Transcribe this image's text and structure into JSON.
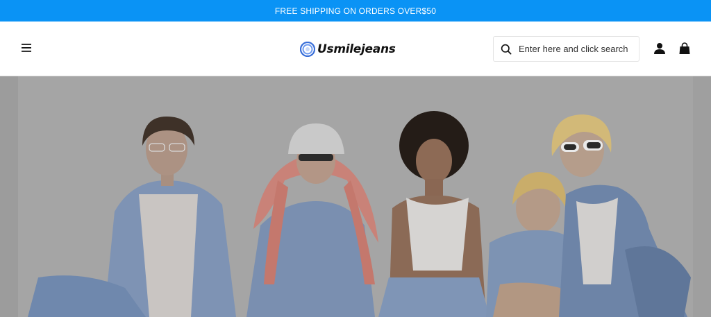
{
  "announcement": {
    "text": "FREE SHIPPING ON ORDERS OVER$50"
  },
  "header": {
    "logo_text": "Usmilejeans",
    "search_placeholder": "Enter here and click search",
    "menu_icon": "hamburger-menu-icon",
    "account_icon": "user-icon",
    "cart_icon": "shopping-bag-icon"
  },
  "colors": {
    "announcement_bg": "#0a93f5",
    "header_bg": "#ffffff",
    "hero_bg": "#a6a6a6"
  }
}
